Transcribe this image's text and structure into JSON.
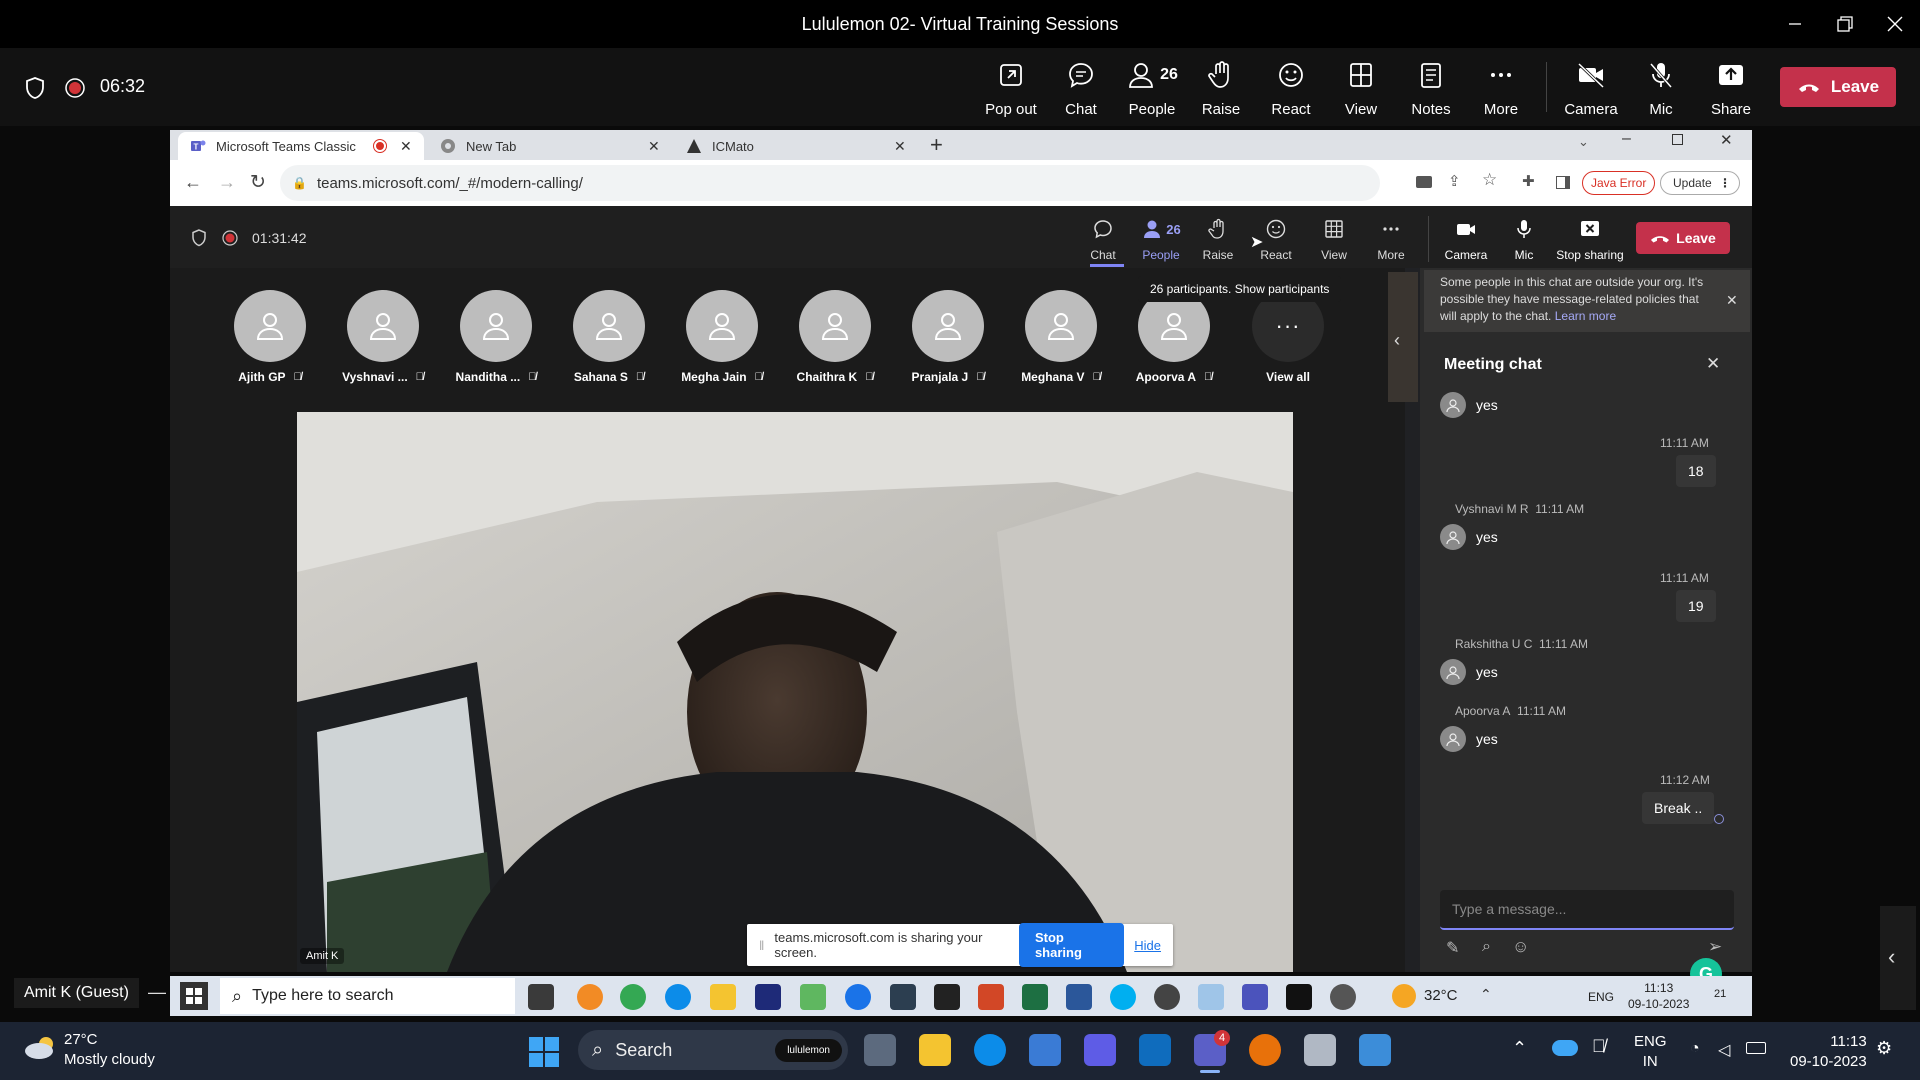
{
  "window": {
    "title": "Lululemon 02- Virtual Training Sessions"
  },
  "toolbar": {
    "timer": "06:32",
    "buttons": [
      {
        "label": "Pop out",
        "icon": "pop-out-icon"
      },
      {
        "label": "Chat",
        "icon": "chat-icon"
      },
      {
        "label": "People",
        "icon": "people-icon",
        "count": "26"
      },
      {
        "label": "Raise",
        "icon": "raise-hand-icon"
      },
      {
        "label": "React",
        "icon": "react-icon"
      },
      {
        "label": "View",
        "icon": "view-icon"
      },
      {
        "label": "Notes",
        "icon": "notes-icon"
      },
      {
        "label": "More",
        "icon": "more-icon"
      },
      {
        "label": "Camera",
        "icon": "camera-off-icon"
      },
      {
        "label": "Mic",
        "icon": "mic-off-icon"
      },
      {
        "label": "Share",
        "icon": "share-icon"
      }
    ],
    "leave_label": "Leave",
    "leave_color": "#c4314b"
  },
  "browser": {
    "tabs": [
      {
        "label": "Microsoft Teams Classic",
        "active": true
      },
      {
        "label": "New Tab",
        "active": false
      },
      {
        "label": "ICMato",
        "active": false
      }
    ],
    "url": "teams.microsoft.com/_#/modern-calling/",
    "error_badge": "Java Error",
    "update_label": "Update"
  },
  "meeting": {
    "timer": "01:31:42",
    "buttons": [
      {
        "label": "Chat",
        "icon": "chat-icon"
      },
      {
        "label": "People",
        "icon": "people-icon",
        "count": "26"
      },
      {
        "label": "Raise",
        "icon": "raise-hand-icon"
      },
      {
        "label": "React",
        "icon": "react-icon"
      },
      {
        "label": "View",
        "icon": "view-icon"
      },
      {
        "label": "More",
        "icon": "more-icon"
      },
      {
        "label": "Camera",
        "icon": "camera-icon"
      },
      {
        "label": "Mic",
        "icon": "mic-icon"
      },
      {
        "label": "Stop sharing",
        "icon": "stop-sharing-icon"
      }
    ],
    "leave_label": "Leave",
    "tooltip": "26 participants. Show participants",
    "participants": [
      {
        "name": "Ajith GP"
      },
      {
        "name": "Vyshnavi ..."
      },
      {
        "name": "Nanditha ..."
      },
      {
        "name": "Sahana S"
      },
      {
        "name": "Megha Jain"
      },
      {
        "name": "Chaithra K"
      },
      {
        "name": "Pranjala J"
      },
      {
        "name": "Meghana V"
      },
      {
        "name": "Apoorva A"
      }
    ],
    "view_all_label": "View all",
    "video_label": "Amit K"
  },
  "chat": {
    "notice": "Some people in this chat are outside your org. It's possible they have message-related policies that will apply to the chat.",
    "notice_link": "Learn more",
    "title": "Meeting chat",
    "messages": [
      {
        "type": "other",
        "sender": "",
        "time": "",
        "text": "yes"
      },
      {
        "type": "self",
        "time": "11:11 AM",
        "text": "18"
      },
      {
        "type": "other",
        "sender": "Vyshnavi M R",
        "time": "11:11 AM",
        "text": "yes"
      },
      {
        "type": "self",
        "time": "11:11 AM",
        "text": "19"
      },
      {
        "type": "other",
        "sender": "Rakshitha U C",
        "time": "11:11 AM",
        "text": "yes"
      },
      {
        "type": "other",
        "sender": "Apoorva A",
        "time": "11:11 AM",
        "text": "yes"
      },
      {
        "type": "self",
        "time": "11:12 AM",
        "text": "Break .."
      }
    ],
    "compose_placeholder": "Type a message..."
  },
  "share_banner": {
    "text": "teams.microsoft.com is sharing your screen.",
    "stop_label": "Stop sharing",
    "hide_label": "Hide"
  },
  "remote_taskbar": {
    "search_placeholder": "Type here to search",
    "temp": "32°C",
    "lang": "ENG",
    "time": "11:13",
    "date": "09-10-2023",
    "notif_count": "21"
  },
  "guest_label": "Amit K (Guest)",
  "taskbar": {
    "weather_temp": "27°C",
    "weather_desc": "Mostly cloudy",
    "search_label": "Search",
    "pill_label": "lululemon",
    "teams_badge": "4",
    "lang_top": "ENG",
    "lang_bottom": "IN",
    "time": "11:13",
    "date": "09-10-2023"
  }
}
